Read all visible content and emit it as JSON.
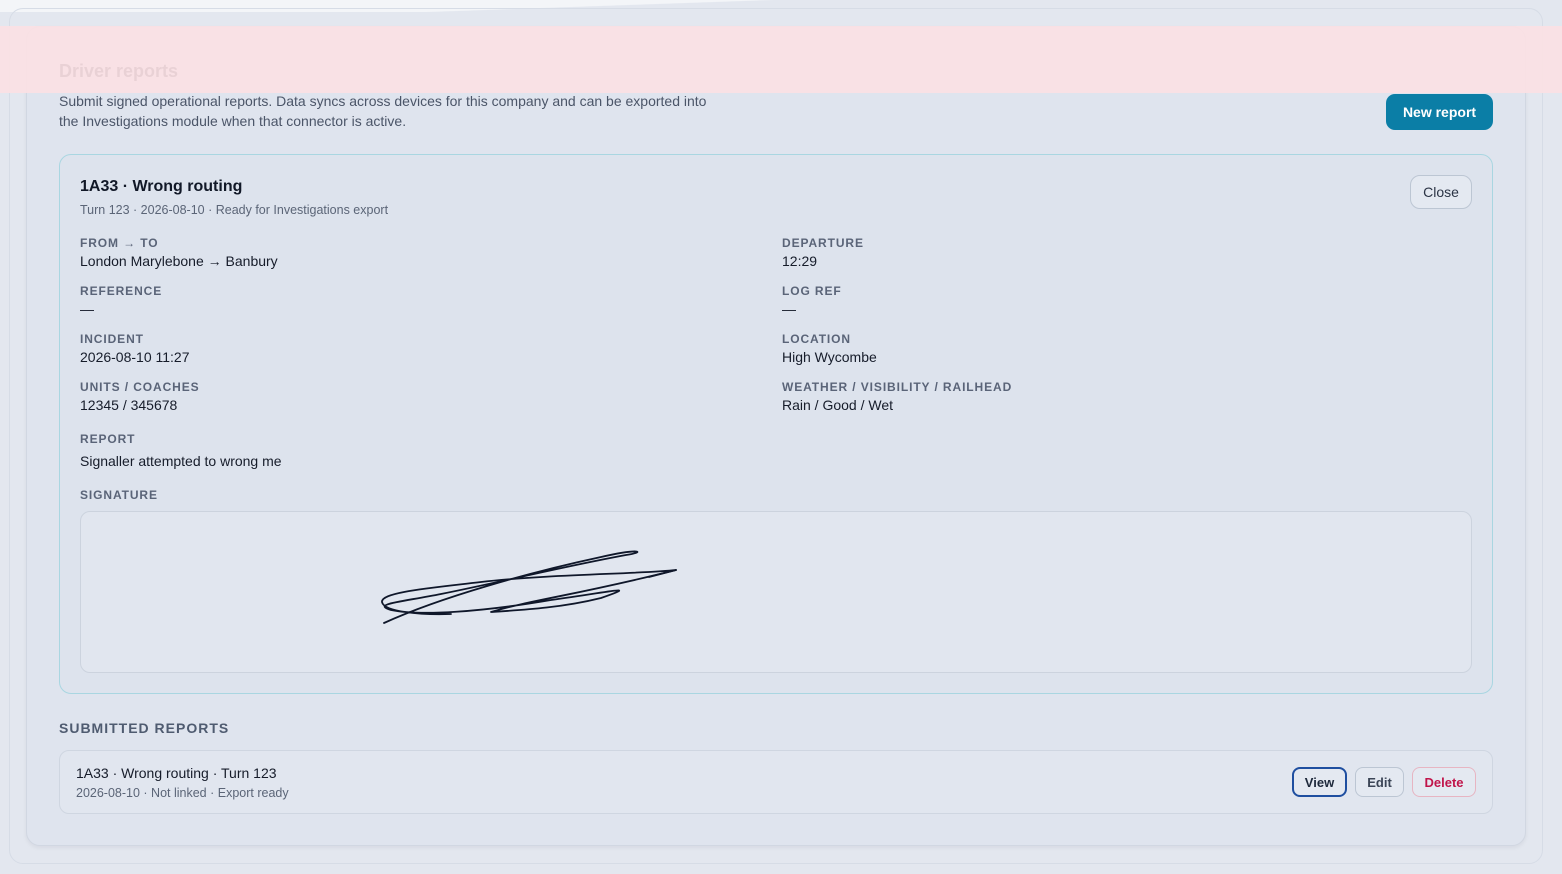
{
  "header": {
    "title": "Driver reports",
    "description": "Submit signed operational reports. Data syncs across devices for this company and can be exported into the Investigations module when that connector is active.",
    "new_report_label": "New report"
  },
  "detail": {
    "title": "1A33 · Wrong routing",
    "subtitle": "Turn 123 · 2026-08-10 · Ready for Investigations export",
    "close_label": "Close",
    "fields": {
      "from_to": {
        "label": "FROM → TO",
        "value": "London Marylebone → Banbury"
      },
      "departure": {
        "label": "DEPARTURE",
        "value": "12:29"
      },
      "reference": {
        "label": "REFERENCE",
        "value": "—"
      },
      "log_ref": {
        "label": "LOG REF",
        "value": "—"
      },
      "incident": {
        "label": "INCIDENT",
        "value": "2026-08-10 11:27"
      },
      "location": {
        "label": "LOCATION",
        "value": "High Wycombe"
      },
      "units": {
        "label": "UNITS / COACHES",
        "value": "12345 / 345678"
      },
      "weather": {
        "label": "WEATHER / VISIBILITY / RAILHEAD",
        "value": "Rain / Good / Wet"
      },
      "report": {
        "label": "REPORT",
        "value": "Signaller attempted to wrong me"
      },
      "signature": {
        "label": "SIGNATURE"
      }
    }
  },
  "submitted": {
    "section_title": "SUBMITTED REPORTS",
    "items": [
      {
        "title": "1A33 · Wrong routing · Turn 123",
        "meta": "2026-08-10 · Not linked · Export ready",
        "view_label": "View",
        "edit_label": "Edit",
        "delete_label": "Delete"
      }
    ]
  },
  "colors": {
    "primary": "#0b7ea6",
    "danger": "#c0144a",
    "card_border": "#a9d6e1"
  }
}
